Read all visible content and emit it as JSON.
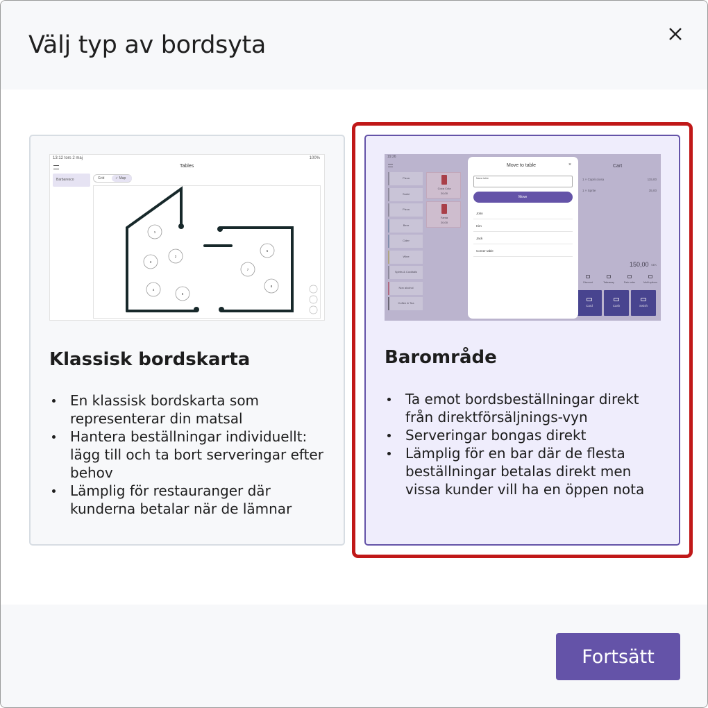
{
  "dialog": {
    "title": "Välj typ av bordsyta",
    "continue_label": "Fortsätt"
  },
  "options": [
    {
      "title": "Klassisk bordskarta",
      "selected": false,
      "bullets": [
        "En klassisk bordskarta som representerar din matsal",
        "Hantera beställningar individuellt: lägg till och ta bort serveringar efter behov",
        "Lämplig för restauranger där kunderna betalar när de lämnar"
      ],
      "preview": {
        "status_left": "13:12  tors 2 maj",
        "status_right": "100%",
        "screen_title": "Tables",
        "sidebar_item": "Barbaresco",
        "toggle_grid": "Grid",
        "toggle_map": "✓ Map",
        "tables": [
          "1",
          "2",
          "3",
          "4",
          "5",
          "6",
          "7",
          "8"
        ]
      }
    },
    {
      "title": "Barområde",
      "selected": true,
      "bullets": [
        "Ta emot bordsbeställningar direkt från direktförsäljnings-vyn",
        "Serveringar bongas direkt",
        "Lämplig för en bar där de flesta beställningar betalas direkt men vissa kunder vill ha en öppen nota"
      ],
      "preview": {
        "status_left": "19:26",
        "categories": [
          "Pizza",
          "Sushi",
          "Pizza",
          "Beer",
          "Cider",
          "Wine",
          "Spirits & Cocktails",
          "Non alcohol",
          "Coffee & Tea"
        ],
        "products": [
          {
            "name": "Coca Cola",
            "price": "20,00"
          },
          {
            "name": "Fanta",
            "price": "20,00"
          }
        ],
        "modal_title": "Move to table",
        "name_placeholder": "Name table",
        "move_label": "Move",
        "table_names": [
          "John",
          "Kim",
          "Jack",
          "Corner table"
        ],
        "cart_title": "Cart",
        "cart_items": [
          {
            "name": "1 × Capricciosa",
            "price": "115,00"
          },
          {
            "name": "1 × Sprite",
            "price": "35,00"
          }
        ],
        "total": "150,00",
        "currency": "SEK",
        "cart_actions": [
          "Discount",
          "Takeaway",
          "Park order",
          "Multi options"
        ],
        "pay_buttons": [
          "Card",
          "Cash",
          "Swish"
        ]
      }
    }
  ],
  "colors": {
    "accent": "#6453a8",
    "selection_outline": "#c01818"
  }
}
